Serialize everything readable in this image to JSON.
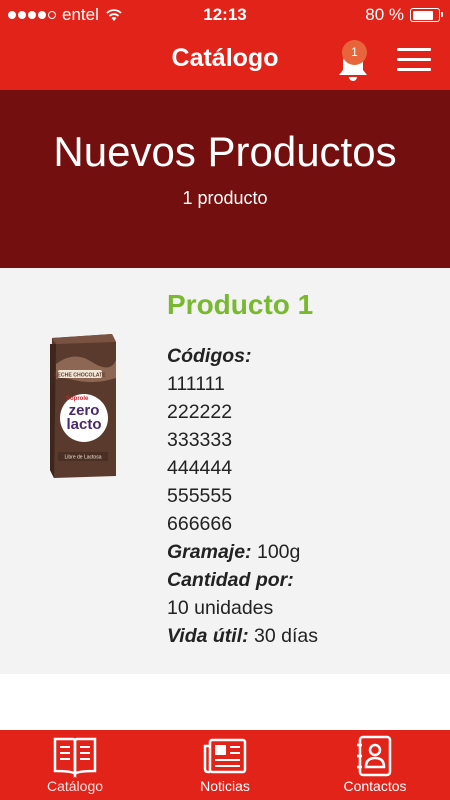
{
  "status_bar": {
    "carrier": "entel",
    "time": "12:13",
    "battery_percent": "80 %",
    "battery_level": 0.8,
    "signal_bars_filled": 4,
    "signal_bars_total": 5
  },
  "header": {
    "title": "Catálogo",
    "notifications_count": "1"
  },
  "hero": {
    "title": "Nuevos Productos",
    "subtitle": "1 producto"
  },
  "product": {
    "name": "Producto 1",
    "codes_label": "Códigos:",
    "codes": [
      "111111",
      "222222",
      "333333",
      "444444",
      "555555",
      "666666"
    ],
    "weight_label": "Gramaje:",
    "weight_value": "100g",
    "quantity_label": "Cantidad por:",
    "quantity_value": "10 unidades",
    "shelf_life_label": "Vida útil:",
    "shelf_life_value": "30 días",
    "image_text": {
      "flavor": "LECHE CHOCOLATE",
      "brand": "Soprole",
      "line1": "zero",
      "line2": "lacto",
      "claim": "Libre de Lactosa"
    }
  },
  "tabs": [
    {
      "label": "Catálogo",
      "icon": "book-icon"
    },
    {
      "label": "Noticias",
      "icon": "newspaper-icon"
    },
    {
      "label": "Contactos",
      "icon": "contacts-icon"
    }
  ],
  "colors": {
    "primary_red": "#e2231a",
    "hero_dark_red": "#730f0e",
    "product_name_green": "#79b92f",
    "badge_orange": "#e8653b",
    "card_background": "#f3f3f3"
  }
}
